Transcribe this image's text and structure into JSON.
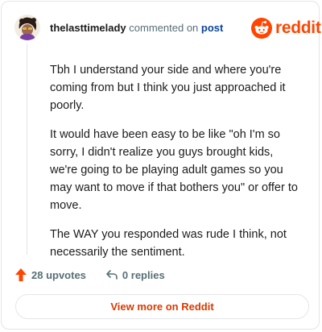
{
  "header": {
    "username": "thelasttimelady",
    "commented_text": "commented on",
    "post_link": "post",
    "logo_text": "reddit",
    "avatar_icon": "user-avatar-icon",
    "logo_icon": "reddit-snoo-icon"
  },
  "comment": {
    "paragraphs": [
      "Tbh I understand your side and where you're coming from but I think you just approached it poorly.",
      "It would have been easy to be like \"oh I'm so sorry, I didn't realize you guys brought kids, we're going to be playing adult games so you may want to move if that bothers you\" or offer to move.",
      "The WAY you responded was rude I think, not necessarily the sentiment."
    ]
  },
  "actions": {
    "upvotes": "28 upvotes",
    "replies": "0 replies",
    "upvote_icon": "upvote-arrow-icon",
    "reply_icon": "reply-arrow-icon"
  },
  "footer": {
    "view_more": "View more on Reddit"
  },
  "colors": {
    "brand": "#ff4500",
    "link": "#0a449b",
    "muted": "#576f76",
    "cta": "#d93a00"
  }
}
